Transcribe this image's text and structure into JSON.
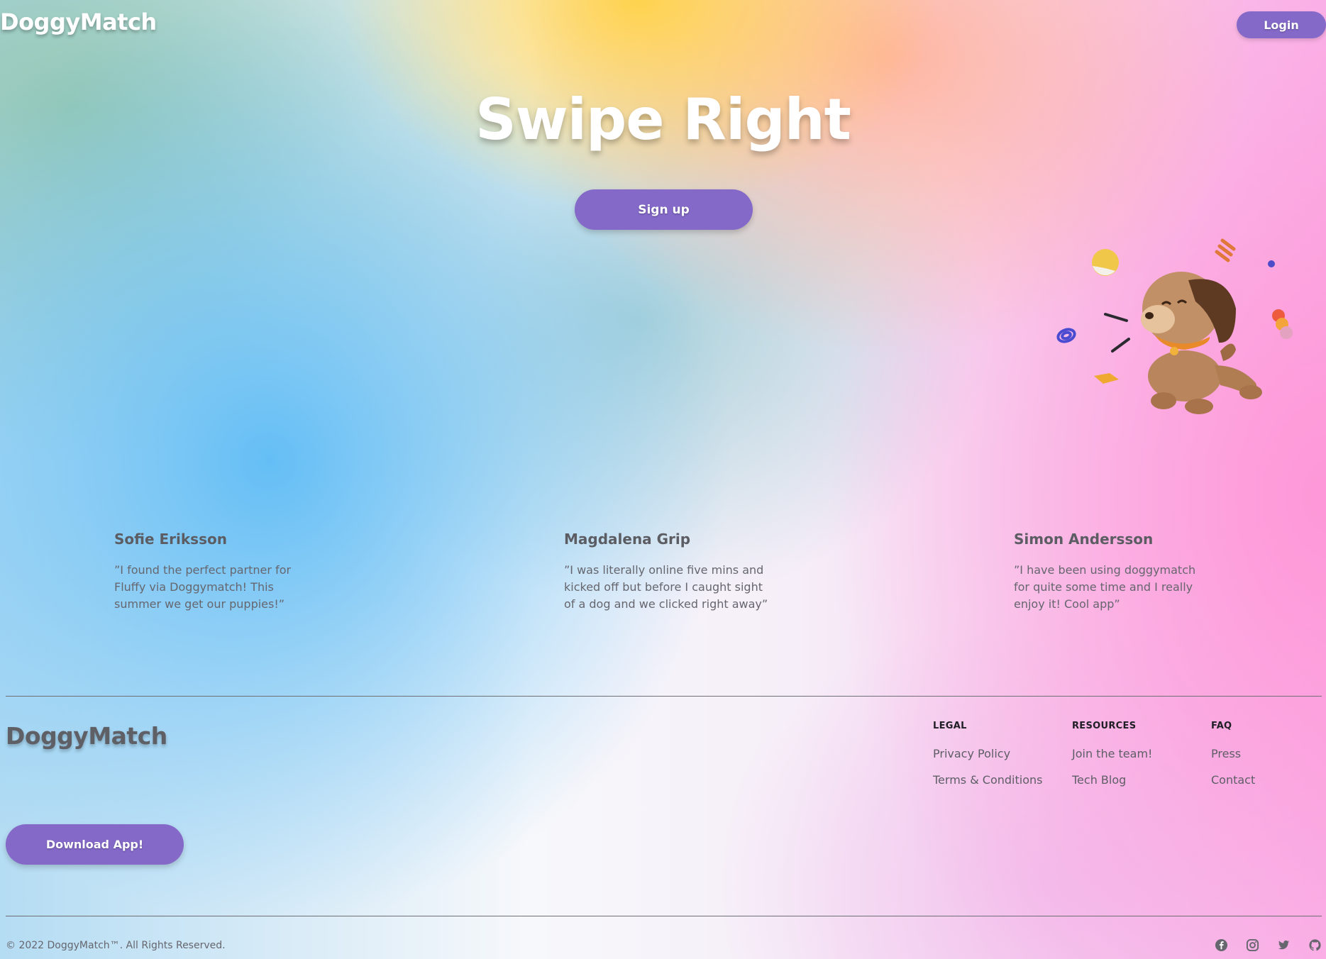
{
  "header": {
    "brand": "DoggyMatch",
    "login_label": "Login"
  },
  "hero": {
    "title": "Swipe Right",
    "signup_label": "Sign up"
  },
  "testimonials": [
    {
      "name": "Sofie Eriksson",
      "quote": "”I found the perfect partner for Fluffy via Doggymatch! This summer we get our puppies!”"
    },
    {
      "name": "Magdalena Grip",
      "quote": "”I was literally online five mins and kicked off but before I caught sight of a dog and we clicked right away”"
    },
    {
      "name": "Simon Andersson",
      "quote": "”I have been using doggymatch for quite some time and I really enjoy it! Cool app”"
    }
  ],
  "footer": {
    "brand": "DoggyMatch",
    "download_label": "Download App!",
    "columns": [
      {
        "heading": "LEGAL",
        "links": [
          "Privacy Policy",
          "Terms & Conditions"
        ]
      },
      {
        "heading": "RESOURCES",
        "links": [
          "Join the team!",
          "Tech Blog"
        ]
      },
      {
        "heading": "FAQ",
        "links": [
          "Press",
          "Contact"
        ]
      }
    ],
    "copyright": "© 2022 DoggyMatch™. All Rights Reserved.",
    "socials": [
      "facebook-icon",
      "instagram-icon",
      "twitter-icon",
      "github-icon"
    ]
  },
  "colors": {
    "accent": "#8469c9",
    "text_muted": "#5e5e66"
  }
}
